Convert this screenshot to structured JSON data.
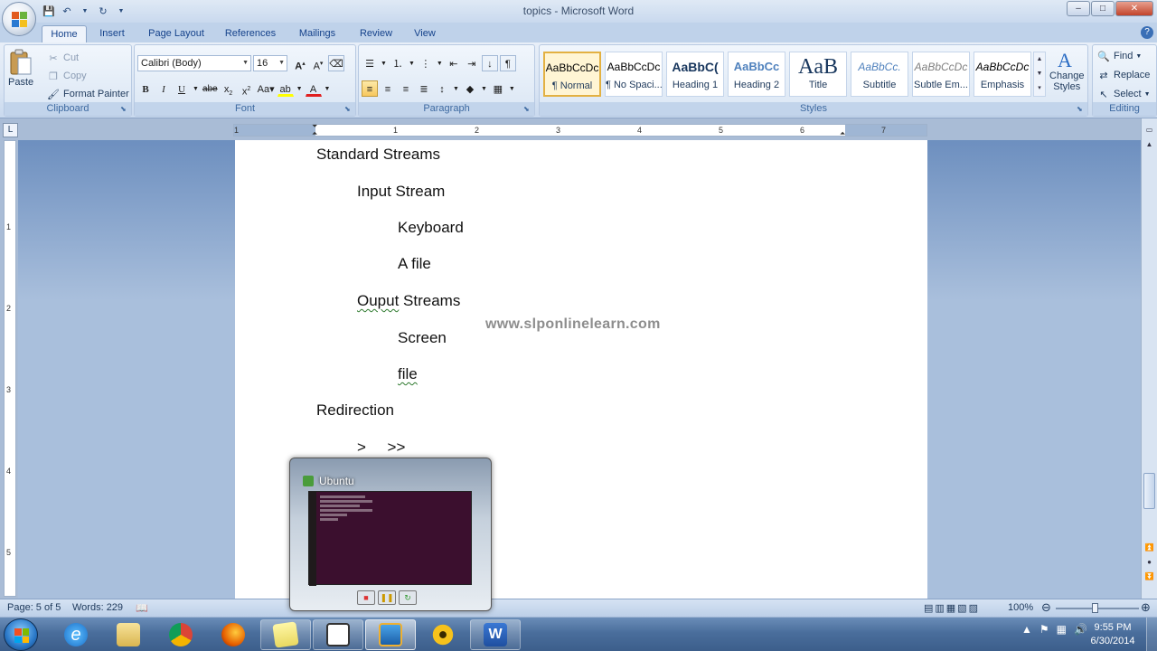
{
  "window": {
    "title": "topics - Microsoft Word",
    "minimize": "–",
    "maximize": "□",
    "close": "✕"
  },
  "ribbon_tabs": [
    "Home",
    "Insert",
    "Page Layout",
    "References",
    "Mailings",
    "Review",
    "View"
  ],
  "active_tab": "Home",
  "clipboard": {
    "paste": "Paste",
    "cut": "Cut",
    "copy": "Copy",
    "format_painter": "Format Painter",
    "label": "Clipboard"
  },
  "font": {
    "family": "Calibri (Body)",
    "size": "16",
    "label": "Font"
  },
  "paragraph": {
    "label": "Paragraph"
  },
  "styles": {
    "label": "Styles",
    "items": [
      {
        "sample": "AaBbCcDc",
        "name": "¶ Normal"
      },
      {
        "sample": "AaBbCcDc",
        "name": "¶ No Spaci..."
      },
      {
        "sample": "AaBbC(",
        "name": "Heading 1"
      },
      {
        "sample": "AaBbCc",
        "name": "Heading 2"
      },
      {
        "sample": "AaB",
        "name": "Title"
      },
      {
        "sample": "AaBbCc.",
        "name": "Subtitle"
      },
      {
        "sample": "AaBbCcDc",
        "name": "Subtle Em..."
      },
      {
        "sample": "AaBbCcDc",
        "name": "Emphasis"
      }
    ],
    "change_styles": "Change Styles",
    "change_styles_line1": "Change",
    "change_styles_line2": "Styles"
  },
  "editing": {
    "find": "Find",
    "replace": "Replace",
    "select": "Select",
    "label": "Editing"
  },
  "ruler_numbers": [
    "1",
    "1",
    "2",
    "3",
    "4",
    "5",
    "6",
    "7"
  ],
  "vruler_numbers": [
    "1",
    "2",
    "3",
    "4",
    "5"
  ],
  "document": {
    "lines": [
      "Standard Streams",
      "Input Stream",
      "Keyboard",
      "A file",
      "Ouput Streams",
      "Screen",
      "file",
      "Redirection",
      ">     >>"
    ],
    "watermark": "www.slponlinelearn.com"
  },
  "thumbnail": {
    "title": "Ubuntu"
  },
  "status": {
    "page": "Page: 5 of 5",
    "words": "Words: 229",
    "zoom": "100%"
  },
  "clock": {
    "time": "9:55 PM",
    "date": "6/30/2014"
  },
  "colors": {
    "accent": "#15428b",
    "ribbon_bg": "#dbe6f4",
    "selected_style": "#e3b142",
    "ubuntu_bg": "#3b0f2e"
  }
}
